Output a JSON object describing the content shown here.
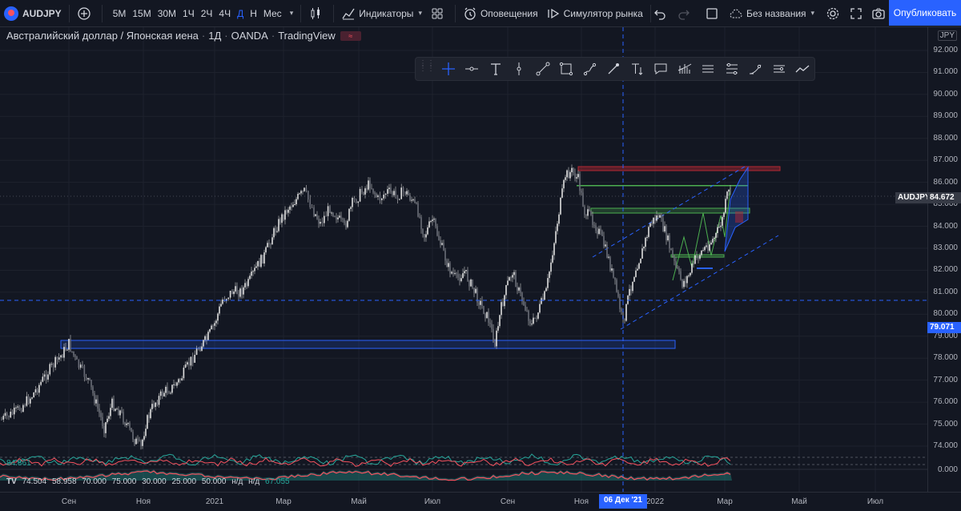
{
  "toolbar": {
    "symbol": "AUDJPY",
    "timeframes": [
      "5М",
      "15М",
      "30М",
      "1Ч",
      "2Ч",
      "4Ч",
      "Д",
      "Н",
      "Мес"
    ],
    "active_timeframe": "Д",
    "indicators_label": "Индикаторы",
    "alerts_label": "Оповещения",
    "replay_label": "Симулятор рынка",
    "layout_name": "Без названия",
    "publish_label": "Опубликовать"
  },
  "chart_title": {
    "instrument": "Австралийский доллар / Японская иена",
    "interval": "1Д",
    "exchange": "OANDA",
    "source": "TradingView"
  },
  "drawing_tools": [
    "crosshair-icon",
    "horizontal-ray-icon",
    "text-icon",
    "vertical-line-icon",
    "trend-line-icon",
    "rectangle-icon",
    "brush-icon",
    "pencil-icon",
    "anchored-text-icon",
    "callout-icon",
    "volume-profile-icon",
    "long-position-icon",
    "short-position-icon",
    "fib-icon",
    "ruler-icon",
    "path-icon"
  ],
  "price_scale": {
    "currency": "JPY",
    "ticks": [
      "92.000",
      "91.000",
      "90.000",
      "89.000",
      "88.000",
      "87.000",
      "86.000",
      "85.000",
      "84.000",
      "83.000",
      "82.000",
      "81.000",
      "80.000",
      "79.000",
      "78.000",
      "77.000",
      "76.000",
      "75.000",
      "74.000"
    ],
    "last_price_label": "AUDJPY",
    "last_price": "84.672",
    "crosshair_price": "79.071",
    "indicator_zero": "0.000"
  },
  "time_scale": {
    "ticks": [
      "Сен",
      "Ноя",
      "2021",
      "Мар",
      "Май",
      "Июл",
      "Сен",
      "Ноя",
      "2022",
      "Мар",
      "Май",
      "Июл"
    ],
    "crosshair_date": "06 Дек '21"
  },
  "indicators": {
    "upper_value": "84.861",
    "values": [
      "74.504",
      "58.958",
      "70.000",
      "75.000",
      "30.000",
      "25.000",
      "50.000",
      "н/д",
      "н/д",
      "67.055"
    ]
  },
  "colors": {
    "background": "#131722",
    "accent": "#2962ff",
    "resistance": "#b22833",
    "support_zone": "#2962ff",
    "green_level": "#4caf50",
    "candle": "#c8c8c8"
  }
}
